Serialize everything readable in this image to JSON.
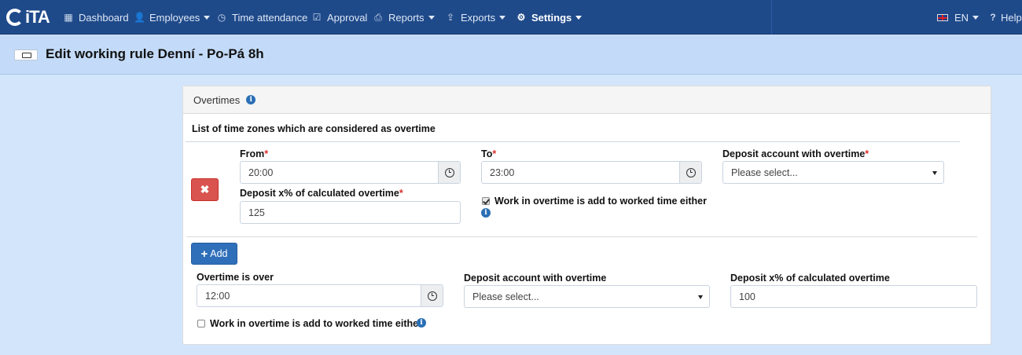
{
  "brand": "iTA",
  "nav": {
    "items": [
      {
        "label": "Dashboard",
        "icon": "dashboard-icon"
      },
      {
        "label": "Employees",
        "icon": "user-icon"
      },
      {
        "label": "Time attendance",
        "icon": "clock-icon"
      },
      {
        "label": "Approval",
        "icon": "check-icon"
      },
      {
        "label": "Reports",
        "icon": "print-icon"
      },
      {
        "label": "Exports",
        "icon": "export-icon"
      },
      {
        "label": "Settings",
        "icon": "gear-icon"
      }
    ],
    "language": "EN",
    "help": "Help"
  },
  "page": {
    "title": "Edit working rule Denní - Po-Pá 8h"
  },
  "panel": {
    "title": "Overtimes",
    "zones_heading": "List of time zones which are considered as overtime",
    "zone": {
      "from_label": "From",
      "from_value": "20:00",
      "to_label": "To",
      "to_value": "23:00",
      "deposit_account_label": "Deposit account with overtime",
      "deposit_account_value": "Please select...",
      "deposit_pct_label": "Deposit x% of calculated overtime",
      "deposit_pct_value": "125",
      "work_checkbox_label": "Work in overtime is add to worked time either",
      "work_checkbox_checked": true,
      "required_mark": "*"
    },
    "add_label": "Add",
    "general": {
      "over_label": "Overtime is over",
      "over_value": "12:00",
      "deposit_account_label": "Deposit account with overtime",
      "deposit_account_value": "Please select...",
      "deposit_pct_label": "Deposit x% of calculated overtime",
      "deposit_pct_value": "100",
      "work_checkbox_label": "Work in overtime is add to worked time either",
      "work_checkbox_checked": false
    }
  },
  "colors": {
    "navbar": "#1f4a8a",
    "background": "#d3e5fb",
    "header": "#c3dbf8",
    "delete_button": "#d9534f",
    "add_button": "#2f6fba",
    "required": "#d9312c"
  }
}
